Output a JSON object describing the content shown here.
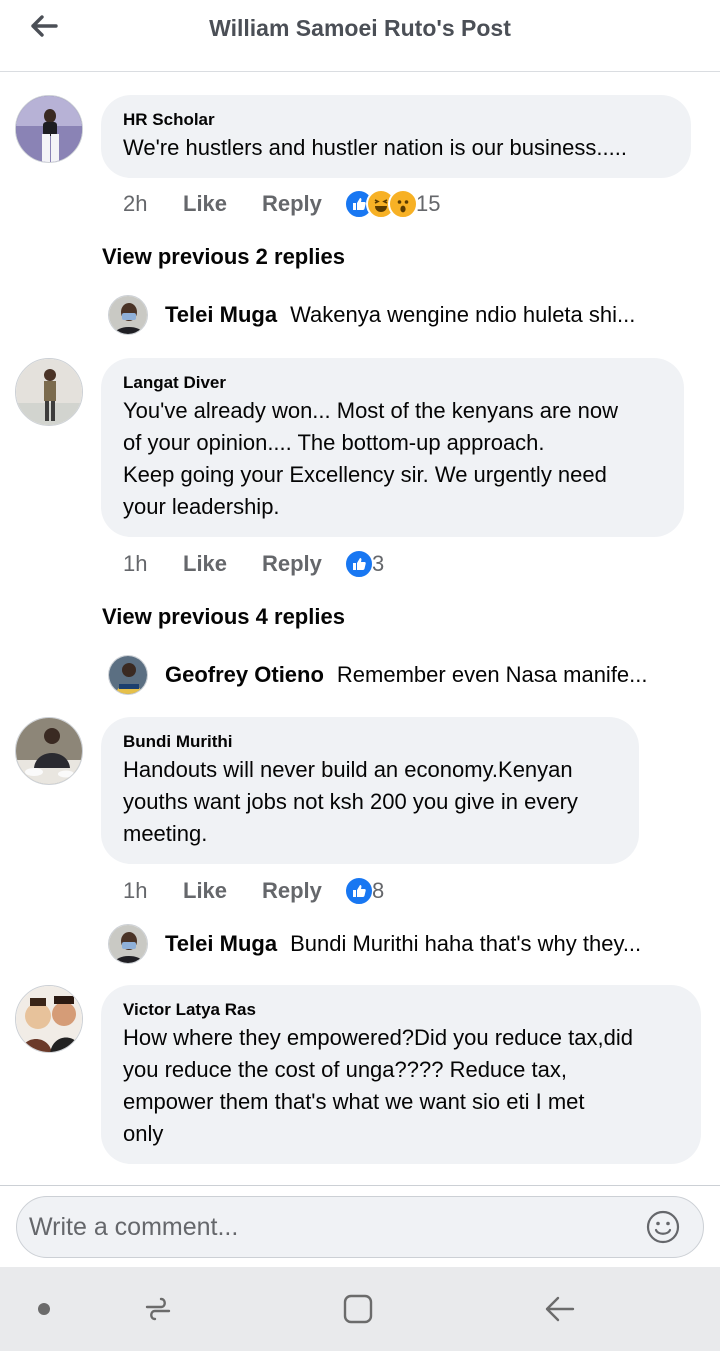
{
  "header": {
    "title": "William Samoei Ruto's Post",
    "back_icon": "back-arrow-icon"
  },
  "comments": [
    {
      "author": "HR Scholar",
      "text": "We're hustlers and hustler nation is our business.....",
      "time": "2h",
      "like_label": "Like",
      "reply_label": "Reply",
      "reactions": [
        "like",
        "haha",
        "wow"
      ],
      "reaction_count": "15",
      "view_previous": "View previous 2 replies",
      "reply": {
        "author": "Telei Muga",
        "text": "Wakenya wengine ndio huleta shi..."
      }
    },
    {
      "author": "Langat Diver",
      "text_lines": [
        "You've already won... Most of the kenyans are now",
        "of your opinion.... The bottom-up approach.",
        "Keep going your Excellency sir. We urgently need",
        "your leadership."
      ],
      "time": "1h",
      "like_label": "Like",
      "reply_label": "Reply",
      "reactions": [
        "like"
      ],
      "reaction_count": "3",
      "view_previous": "View previous 4 replies",
      "reply": {
        "author": "Geofrey Otieno",
        "text": "Remember even Nasa manife..."
      }
    },
    {
      "author": "Bundi Murithi",
      "text_lines": [
        "Handouts will never build an economy.Kenyan",
        "youths want jobs not ksh 200 you give in every",
        "meeting."
      ],
      "time": "1h",
      "like_label": "Like",
      "reply_label": "Reply",
      "reactions": [
        "like"
      ],
      "reaction_count": "8",
      "reply": {
        "author": "Telei Muga",
        "text": "Bundi Murithi haha that's why they..."
      }
    },
    {
      "author": "Victor Latya Ras",
      "text_lines": [
        "How where they empowered?Did you reduce tax,did",
        "you reduce the cost of unga???? Reduce tax,",
        "empower them that's what we want sio eti I met",
        "only"
      ]
    }
  ],
  "composer": {
    "placeholder": "Write a comment...",
    "emoji_icon": "smiley-icon"
  },
  "colors": {
    "bubble": "#f0f2f5",
    "like_blue": "#1877f2",
    "secondary_text": "#65676b",
    "reaction_yellow": "#f7b125"
  }
}
